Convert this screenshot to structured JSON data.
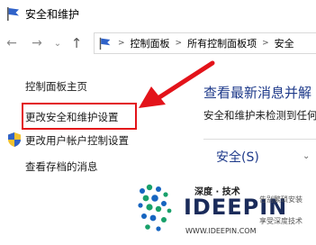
{
  "window": {
    "title": "安全和维护"
  },
  "navbar": {
    "back_icon": "arrow-left-icon",
    "forward_icon": "arrow-right-icon",
    "recent_icon": "chevron-down-icon",
    "up_icon": "arrow-up-icon",
    "breadcrumb": [
      "控制面板",
      "所有控制面板项",
      "安全"
    ]
  },
  "sidebar": {
    "home": "控制面板主页",
    "change_settings": "更改安全和维护设置",
    "uac": "更改用户帐户控制设置",
    "archived": "查看存档的消息"
  },
  "main": {
    "heading": "查看最新消息并解",
    "subtext": "安全和维护未检测到任何",
    "section": "安全(S)"
  },
  "watermark": {
    "title": "深度 · 技术",
    "brand": "IDEEPIN",
    "slogan1": "告别繁琐安装",
    "slogan2": "享受深度技术",
    "site": "WWW.IDEEPIN.COM"
  },
  "colors": {
    "highlight": "#e3131a",
    "heading": "#1e3a8a",
    "brand_navy": "#1a2b5a",
    "logo_green": "#18a06a",
    "logo_blue": "#1665c0"
  }
}
